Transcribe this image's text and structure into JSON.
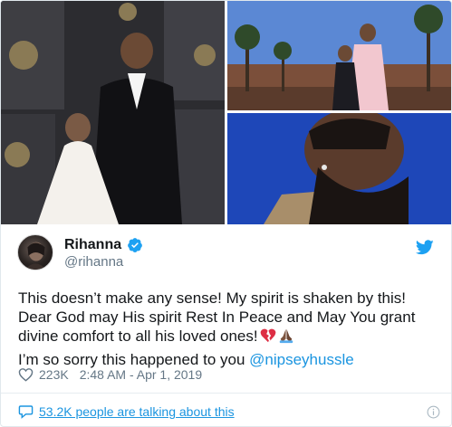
{
  "tweet": {
    "author": {
      "display_name": "Rihanna",
      "handle": "@rihanna",
      "verified": true
    },
    "text_line1": "This doesn’t make any sense! My spirit is shaken by this! Dear God may His spirit Rest In Peace and May You grant divine comfort to all his loved ones!",
    "emojis": [
      "broken-heart-emoji",
      "folded-hands-emoji"
    ],
    "text_line2_prefix": "I’m so sorry this happened to you ",
    "mention": "@nipseyhussle",
    "likes": "223K",
    "timestamp": "2:48 AM - Apr 1, 2019",
    "people_talking": "53.2K people are talking about this",
    "media": [
      {
        "name": "photo-grammy-red-carpet"
      },
      {
        "name": "photo-couple-outdoors"
      },
      {
        "name": "photo-portrait-blue"
      }
    ]
  },
  "colors": {
    "link": "#1b95e0",
    "secondary_text": "#657786",
    "primary_text": "#14171a",
    "twitter_blue": "#1da1f2",
    "border": "#e1e8ed"
  },
  "icons": [
    "verified-badge-icon",
    "twitter-bird-icon",
    "heart-outline-icon",
    "speech-bubble-icon",
    "info-icon"
  ]
}
